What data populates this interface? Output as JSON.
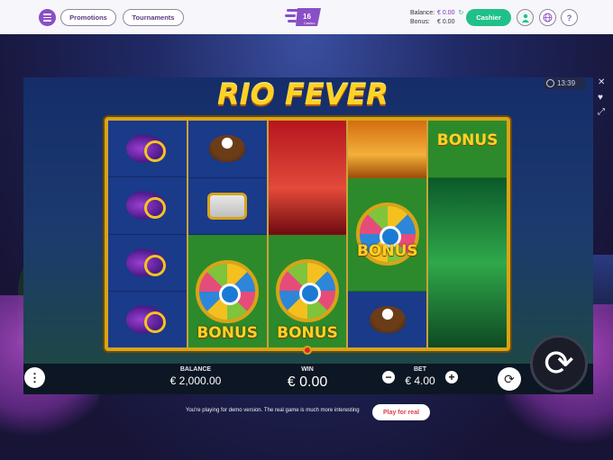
{
  "nav": {
    "promotions_label": "Promotions",
    "tournaments_label": "Tournaments",
    "logo_text": "Casino",
    "balance_label": "Balance:",
    "balance_value": "€ 0.00",
    "bonus_label": "Bonus:",
    "bonus_value": "€ 0.00",
    "cashier_label": "Cashier",
    "help_symbol": "?"
  },
  "game": {
    "title": "RIO FEVER",
    "clock": "13:39",
    "bonus_label": "BONUS",
    "reels": [
      [
        "mask",
        "mask",
        "mask",
        "mask"
      ],
      [
        "coconut",
        "drum",
        "bonus-wheel"
      ],
      [
        "dancer-red",
        "bonus-wheel"
      ],
      [
        "dancer-gold",
        "bonus-wheel",
        "coconut"
      ],
      [
        "bonus-wheel",
        "dancer-green"
      ]
    ]
  },
  "bar": {
    "balance_label": "BALANCE",
    "balance_value": "€ 2,000.00",
    "win_label": "WIN",
    "win_value": "€ 0.00",
    "bet_label": "BET",
    "bet_value": "€ 4.00",
    "minus": "−",
    "plus": "+"
  },
  "demo": {
    "notice": "You're playing for demo version. The real game is much more interesting",
    "play_real_label": "Play for real"
  },
  "colors": {
    "accent": "#8a4fc6",
    "cashier": "#20c089",
    "title_gold": "#ffd224",
    "play_real_text": "#e23b4b"
  },
  "icons": [
    "menu-icon",
    "user-icon",
    "language-icon",
    "help-icon",
    "clock-icon",
    "close-icon",
    "heart-icon",
    "fullscreen-icon",
    "more-icon",
    "autoplay-icon",
    "spin-icon"
  ]
}
